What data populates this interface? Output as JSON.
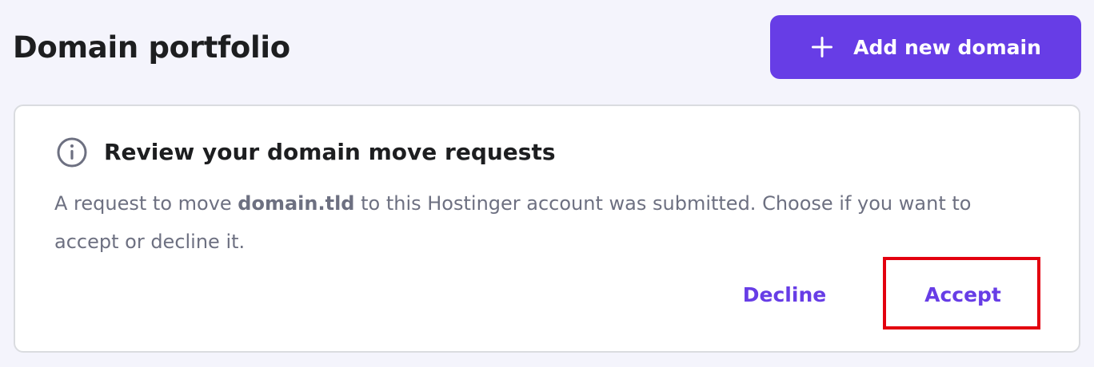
{
  "page": {
    "title": "Domain portfolio",
    "background": "#f4f4fc"
  },
  "header": {
    "add_button_label": "Add new domain",
    "add_button_icon": "plus-icon",
    "accent_color": "#673de6"
  },
  "notice_card": {
    "icon": "info-circle-icon",
    "title": "Review your domain move requests",
    "body_prefix": "A request to move ",
    "domain": "domain.tld",
    "body_suffix": " to this Hostinger account was submitted. Choose if you want to accept or decline it.",
    "decline_label": "Decline",
    "accept_label": "Accept"
  },
  "annotation": {
    "highlight_target": "accept-button",
    "highlight_color": "#e3000f"
  }
}
